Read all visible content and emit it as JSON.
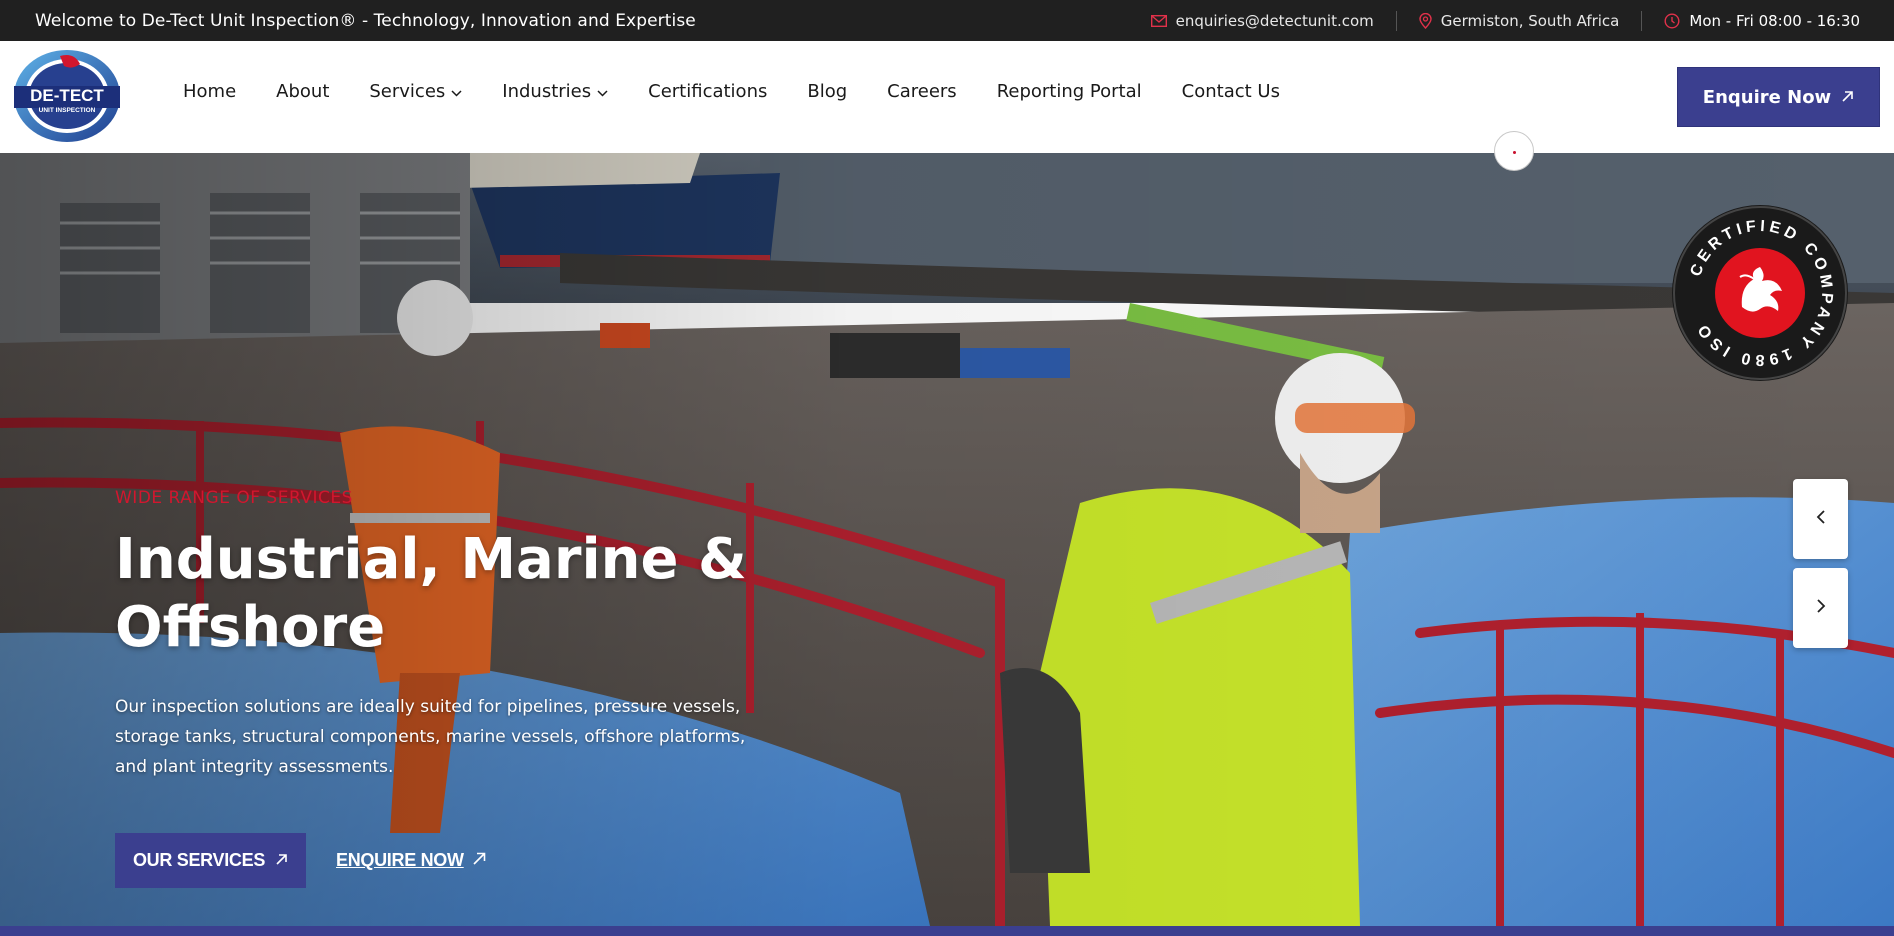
{
  "topbar": {
    "welcome": "Welcome to De-Tect Unit Inspection® - Technology, Innovation and Expertise",
    "email": "enquiries@detectunit.com",
    "location": "Germiston, South Africa",
    "hours": "Mon - Fri 08:00 - 16:30"
  },
  "logo": {
    "brand": "DE-TECT",
    "sub": "UNIT INSPECTION"
  },
  "nav": {
    "items": [
      {
        "label": "Home"
      },
      {
        "label": "About"
      },
      {
        "label": "Services"
      },
      {
        "label": "Industries"
      },
      {
        "label": "Certifications"
      },
      {
        "label": "Blog"
      },
      {
        "label": "Careers"
      },
      {
        "label": "Reporting Portal"
      },
      {
        "label": "Contact Us"
      }
    ],
    "enquire_label": "Enquire Now"
  },
  "hero": {
    "eyebrow": "WIDE RANGE OF SERVICES",
    "title_line1": "Industrial, Marine &",
    "title_line2": "Offshore",
    "description": "Our inspection solutions are ideally suited for pipelines, pressure vessels, storage tanks, structural components, marine vessels, offshore platforms, and plant integrity assessments.",
    "primary_button": "OUR SERVICES",
    "secondary_button": "ENQUIRE NOW"
  },
  "badge": {
    "text": "CERTIFIED COMPANY 1980 ISO"
  },
  "colors": {
    "brand_blue": "#3b3f8f",
    "accent_red": "#d2162e",
    "topbar_bg": "#202020"
  }
}
